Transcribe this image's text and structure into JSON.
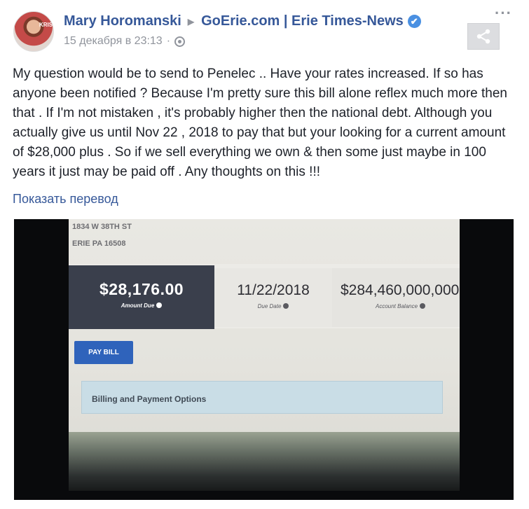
{
  "post": {
    "author": "Mary Horomanski",
    "arrow": "▶",
    "page": "GoErie.com | Erie Times-News",
    "verified_mark": "✔",
    "timestamp": "15 декабря в 23:13",
    "meta_sep": "·",
    "more": "···",
    "avatar_badge": "KRISTEN",
    "text": "My question would be to send to Penelec .. Have your rates increased. If so has anyone been notified ? Because I'm pretty sure this bill alone reflex much more then that . If I'm not mistaken , it's probably higher then the national debt. Although you actually give us until Nov 22 , 2018 to pay that but your looking for a current amount of $28,000 plus . So if we sell everything we own & then some just maybe in 100 years it just may be paid off . Any thoughts on this !!!",
    "translate": "Показать перевод"
  },
  "photo": {
    "address_line1": "1834 W 38TH ST",
    "address_line2": "ERIE PA 16508",
    "amount_due": "$28,176.00",
    "amount_due_label": "Amount Due",
    "due_date": "11/22/2018",
    "due_date_label": "Due Date",
    "account_balance": "$284,460,000,000,",
    "account_balance_label": "Account Balance",
    "pay_bill": "PAY BILL",
    "billing_options": "Billing and Payment Options"
  },
  "icons": {
    "verified": "check-badge-icon",
    "globe": "globe-icon",
    "share": "share-icon",
    "more": "more-options-icon",
    "info": "info-icon"
  },
  "colors": {
    "link_blue": "#365899",
    "meta_gray": "#90949c",
    "verified_blue": "#4a90e2",
    "amount_box": "#3a3f4c",
    "pay_button": "#2f63bb",
    "billing_bar": "#c9dde6"
  }
}
